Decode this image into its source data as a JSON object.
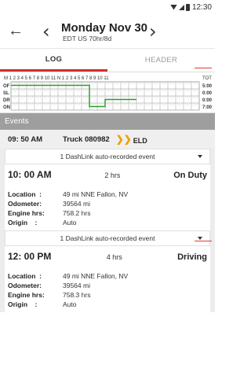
{
  "status": {
    "time": "12:30"
  },
  "header": {
    "date": "Monday Nov 30",
    "sub": "EDT US 70hr/8d"
  },
  "tabs": [
    {
      "label": "LOG",
      "active": true
    },
    {
      "label": "HEADER",
      "active": false
    }
  ],
  "log_grid": {
    "hours_label": "M 1 2 3 4 5 6 7 8 9 10 11 N 1 2 3 4 5 6 7 8 9 10 11",
    "rows": [
      "OF",
      "SL",
      "DR",
      "ON"
    ],
    "tot_label": "TOT",
    "totals": [
      "5:00",
      "0:00",
      "0:00",
      "7:00"
    ],
    "accent": "#2e9e2e"
  },
  "events_heading": "Events",
  "truck_row": {
    "time": "09: 50 AM",
    "truck": "Truck 080982",
    "eld": "ELD"
  },
  "events": [
    {
      "dash_label": "1 DashLink auto-recorded event",
      "time": "10: 00 AM",
      "duration": "2 hrs",
      "status": "On Duty",
      "location_label": "Location",
      "location": "49 mi NNE Fallon, NV",
      "odometer_label": "Odometer",
      "odometer": "39564 mi",
      "engine_label": "Engine hrs",
      "engine": "758.2 hrs",
      "origin_label": "Origin",
      "origin": "Auto"
    },
    {
      "dash_label": "1 DashLink auto-recorded event",
      "time": "12: 00 PM",
      "duration": "4 hrs",
      "status": "Driving",
      "location_label": "Location",
      "location": "49 mi NNE Fallon, NV",
      "odometer_label": "Odometer",
      "odometer": "39564 mi",
      "engine_label": "Engine hrs",
      "engine": "758.3 hrs",
      "origin_label": "Origin",
      "origin": "Auto"
    }
  ]
}
